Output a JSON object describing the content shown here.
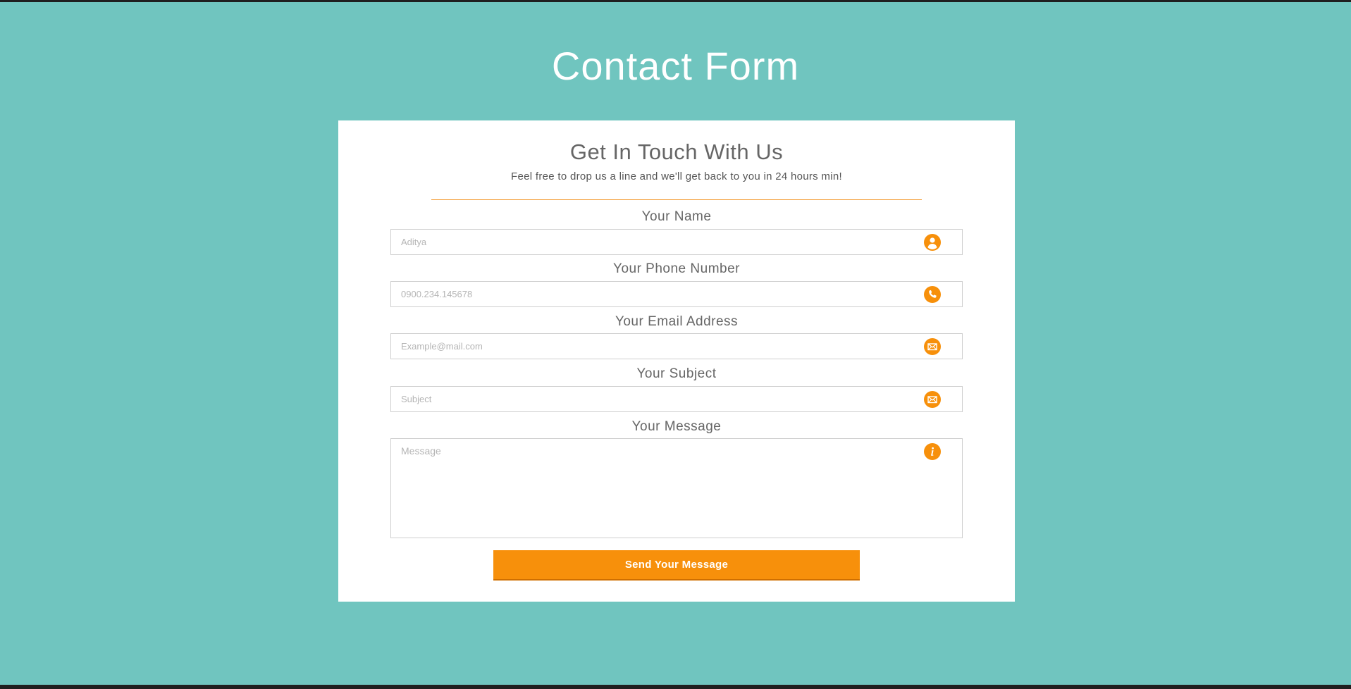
{
  "page": {
    "title": "Contact Form"
  },
  "card": {
    "heading": "Get In Touch With Us",
    "subheading": "Feel free to drop us a line and we'll get back to you in 24 hours min!"
  },
  "fields": {
    "name": {
      "label": "Your Name",
      "placeholder": "Aditya",
      "icon": "user-icon"
    },
    "phone": {
      "label": "Your Phone Number",
      "placeholder": "0900.234.145678",
      "icon": "phone-icon"
    },
    "email": {
      "label": "Your Email Address",
      "placeholder": "Example@mail.com",
      "icon": "envelope-icon"
    },
    "subject": {
      "label": "Your Subject",
      "placeholder": "Subject",
      "icon": "envelope-icon"
    },
    "message": {
      "label": "Your Message",
      "placeholder": "Message",
      "icon": "info-icon"
    }
  },
  "submit": {
    "label": "Send Your Message"
  },
  "colors": {
    "background": "#70c5bf",
    "accent": "#f7900b",
    "card": "#ffffff",
    "text": "#666666"
  }
}
